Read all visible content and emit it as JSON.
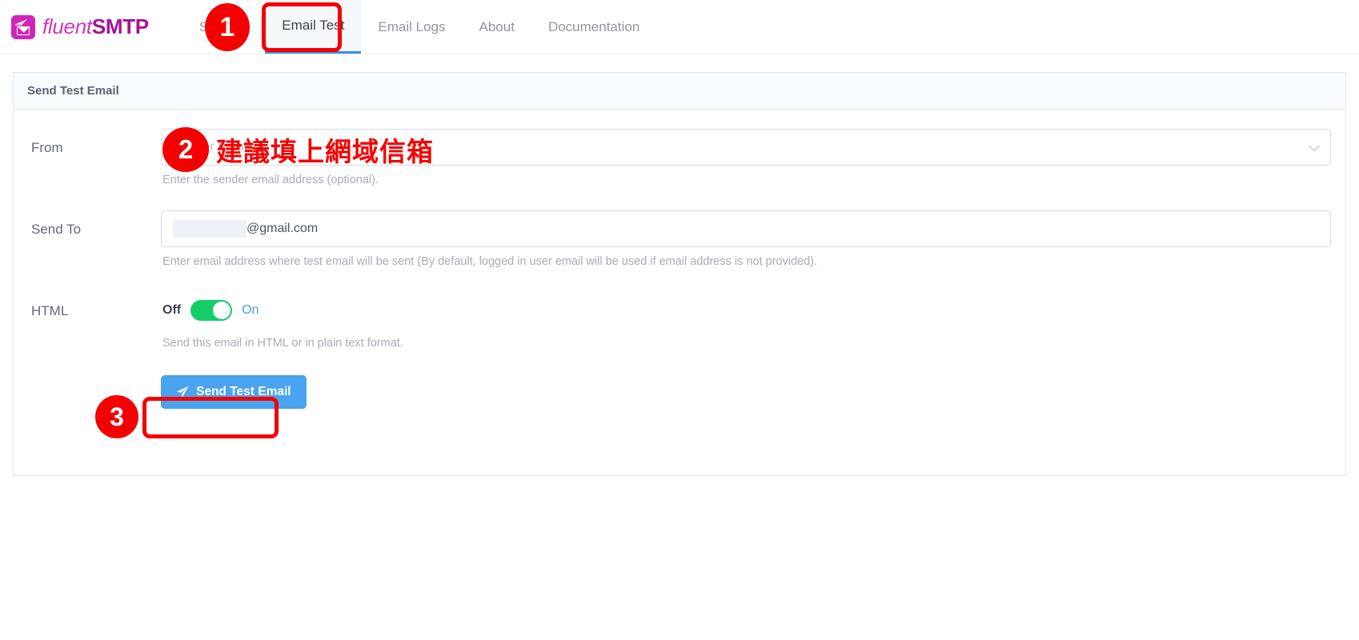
{
  "brand": {
    "name_light": "fluent",
    "name_bold": "SMTP",
    "icon": "envelope-speed-icon",
    "color_light": "#d136c0",
    "color_bold": "#a5119b"
  },
  "nav": {
    "tabs": [
      {
        "label": "Settings",
        "active": false
      },
      {
        "label": "Email Test",
        "active": true
      },
      {
        "label": "Email Logs",
        "active": false
      },
      {
        "label": "About",
        "active": false
      },
      {
        "label": "Documentation",
        "active": false
      }
    ],
    "active_underline_color": "#3a8ee6"
  },
  "card": {
    "title": "Send Test Email"
  },
  "form": {
    "from": {
      "label": "From",
      "placeholder": "Sender Email",
      "value": "",
      "help": "Enter the sender email address (optional).",
      "chevron": "chevron-down-icon"
    },
    "send_to": {
      "label": "Send To",
      "value_redacted": true,
      "value_visible": "@gmail.com",
      "help": "Enter email address where test email will be sent (By default, logged in user email will be used if email address is not provided)."
    },
    "html": {
      "label": "HTML",
      "off_label": "Off",
      "on_label": "On",
      "state_on": true,
      "toggle_color": "#13ce66",
      "help": "Send this email in HTML or in plain text format."
    },
    "submit": {
      "label": "Send Test Email",
      "icon": "paper-plane-icon",
      "color": "#4aa3f0"
    }
  },
  "annotations": {
    "color": "#f40000",
    "badges": [
      {
        "id": "badge1",
        "number": "1"
      },
      {
        "id": "badge2",
        "number": "2"
      },
      {
        "id": "badge3",
        "number": "3"
      }
    ],
    "note_text": "建議填上網域信箱"
  }
}
